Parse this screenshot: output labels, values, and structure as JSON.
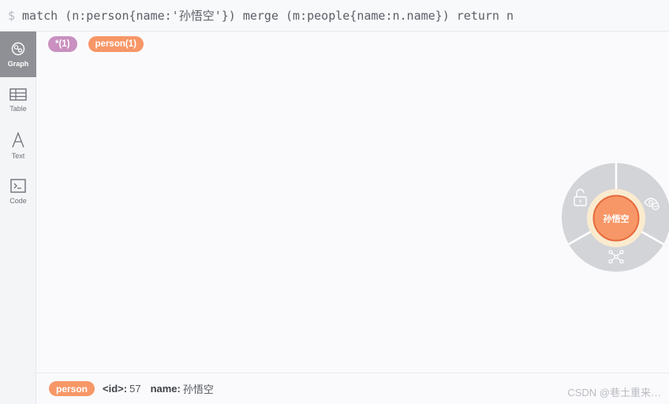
{
  "query": {
    "prompt": "$",
    "text": "match (n:person{name:'孙悟空'}) merge (m:people{name:n.name}) return n"
  },
  "sidebar": {
    "items": [
      {
        "label": "Graph",
        "icon": "graph-icon",
        "active": true
      },
      {
        "label": "Table",
        "icon": "table-icon",
        "active": false
      },
      {
        "label": "Text",
        "icon": "text-icon",
        "active": false
      },
      {
        "label": "Code",
        "icon": "code-icon",
        "active": false
      }
    ]
  },
  "labels": {
    "all": "*(1)",
    "person": "person(1)"
  },
  "node": {
    "caption": "孙悟空",
    "color": "#f79767",
    "ring_actions": [
      "unlock-icon",
      "hide-eye-icon",
      "expand-relationships-icon"
    ]
  },
  "status": {
    "label": "person",
    "id_key": "<id>:",
    "id_value": "57",
    "name_key": "name:",
    "name_value": "孙悟空"
  },
  "watermark": "CSDN @巷土重来…"
}
